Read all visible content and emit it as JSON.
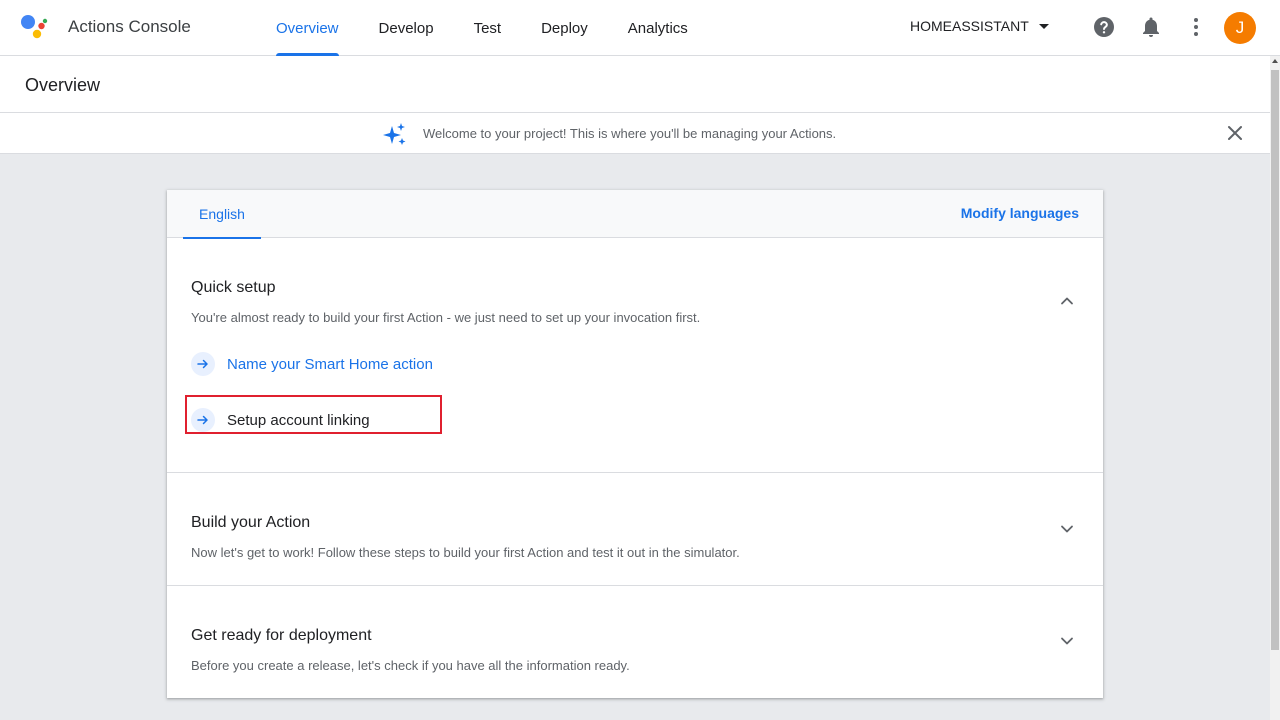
{
  "header": {
    "app_title": "Actions Console",
    "nav": [
      {
        "label": "Overview",
        "active": true
      },
      {
        "label": "Develop",
        "active": false
      },
      {
        "label": "Test",
        "active": false
      },
      {
        "label": "Deploy",
        "active": false
      },
      {
        "label": "Analytics",
        "active": false
      }
    ],
    "project_name": "HOMEASSISTANT",
    "avatar_initial": "J",
    "icons": [
      "help-icon",
      "notifications-icon",
      "more-vert-icon"
    ]
  },
  "page": {
    "title": "Overview"
  },
  "banner": {
    "text": "Welcome to your project! This is where you'll be managing your Actions."
  },
  "card": {
    "language_tab": "English",
    "modify_languages": "Modify languages",
    "sections": [
      {
        "title": "Quick setup",
        "description": "You're almost ready to build your first Action - we just need to set up your invocation first.",
        "expanded": true,
        "steps": [
          {
            "label": "Name your Smart Home action",
            "highlighted": true
          },
          {
            "label": "Setup account linking",
            "highlighted": false
          }
        ]
      },
      {
        "title": "Build your Action",
        "description": "Now let's get to work! Follow these steps to build your first Action and test it out in the simulator.",
        "expanded": false
      },
      {
        "title": "Get ready for deployment",
        "description": "Before you create a release, let's check if you have all the information ready.",
        "expanded": false
      }
    ]
  },
  "colors": {
    "accent": "#1a73e8",
    "avatar": "#f57c00",
    "highlight_box": "#e0202f"
  }
}
